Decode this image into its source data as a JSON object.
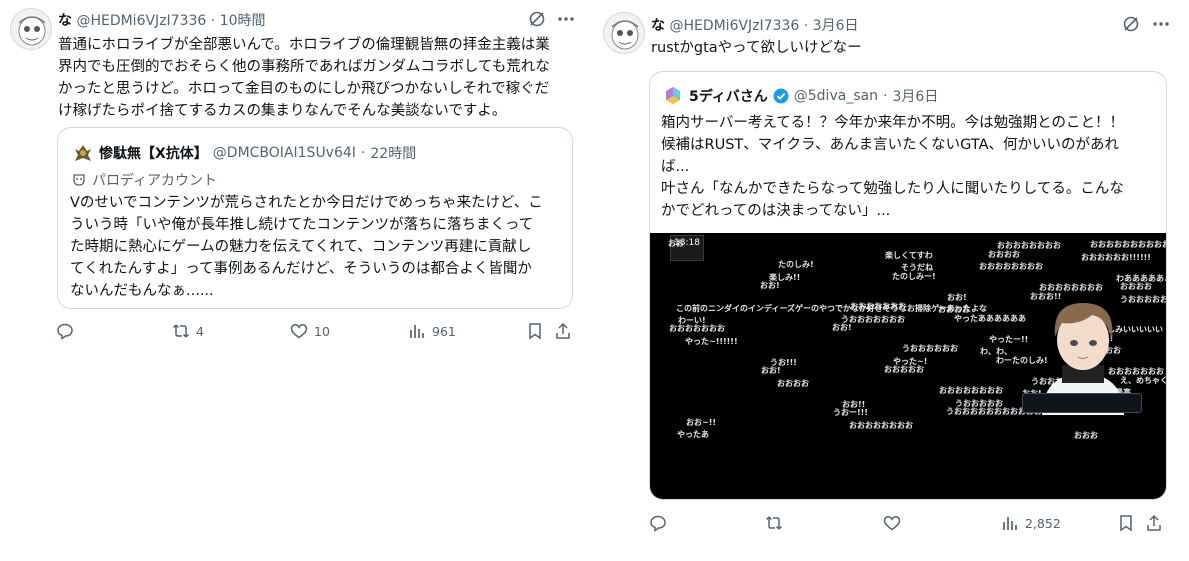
{
  "left_tweet": {
    "display_name": "な",
    "handle": "@HEDMi6VJzI7336",
    "time": "10時間",
    "text_lines": [
      "普通にホロライブが全部悪いんで。ホロライブの倫理観皆無の拝金主義は業",
      "界内でも圧倒的でおそらく他の事務所であればガンダムコラボしても荒れな",
      "かったと思うけど。ホロって金目のものにしか飛びつかないしそれで稼ぐだ",
      "け稼げたらポイ捨てするカスの集まりなんでそんな美談ないですよ。"
    ],
    "quote": {
      "display_name": "惨駄無【X抗体】",
      "handle": "@DMCBOIAI1SUv64I",
      "time": "22時間",
      "parody_label": "パロディアカウント",
      "text_lines": [
        "Vのせいでコンテンツが荒らされたとか今日だけでめっちゃ来たけど、こ",
        "ういう時「いや俺が長年推し続けてたコンテンツが落ちに落ちまくって",
        "た時期に熱心にゲームの魅力を伝えてくれて、コンテンツ再建に貢献し",
        "てくれたんすよ」って事例あるんだけど、そういうのは都合よく皆聞か",
        "ないんだもんなぁ......"
      ]
    },
    "actions": {
      "reply_count": "",
      "retweet_count": "4",
      "like_count": "10",
      "view_count": "961"
    }
  },
  "right_tweet": {
    "display_name": "な",
    "handle": "@HEDMi6VJzI7336",
    "time": "3月6日",
    "text": "rustかgtaやって欲しいけどなー",
    "quote": {
      "display_name": "5ディバさん",
      "handle": "@5diva_san",
      "time": "3月6日",
      "text_lines": [
        "箱内サーバー考えてる！？今年か来年か不明。今は勉強期とのこと！！",
        "候補はRUST、マイクラ、あんま言いたくないGTA、何かいいのがあれ",
        "ば...",
        "叶さん「なんかできたらなって勉強したり人に聞いたりしてる。こんな",
        "かでどれってのは決まってない」..."
      ],
      "video_clock": "18:18",
      "danmaku": [
        "おお",
        "おおおおおお!!!!!!",
        "おおおおおおおお",
        "たのしみー!",
        "おお!",
        "うおおおおおおあっつい",
        "この前のニンダイのインディーズゲーのやつでかなか好きそうなお掃除ゲーあったよな",
        "やったああああああ",
        "おお!",
        "やった~!!!!!!",
        "おおおおおお",
        "わーたのしみ!",
        "おおおおお",
        "おおおお",
        "最高",
        "楽しみです!",
        "うおおおおおおおおおおおおおおお",
        "おおおおおおおお",
        "やったあ",
        "おおおおおおおおおおおお",
        "おおおお",
        "そうだね",
        "楽しみ!!",
        "おおおお",
        "おおお!!",
        "おおおお",
        "うおおおおおおお",
        "おおおおおおお",
        "楽しみ!!",
        "わ、わ、",
        "やった~!",
        "おお!",
        "え、めちゃくちゃ",
        "おお!",
        "うおおおおお",
        "うおー!!!",
        "おお~!!",
        "おおお",
        "おおおおおおおお",
        "楽しくてすわ",
        "たのしみ!",
        "わあああああぁ",
        "おおおおおおおお",
        "おお!",
        "おおおおおおお",
        "わーい!",
        "たのしみいいいいい",
        "やったー!!",
        "うおおおおおお",
        "うお!!!",
        "おおおおおおお",
        "うおおおおお",
        "おおおおおおおお",
        "おお!!"
      ]
    },
    "actions": {
      "reply_count": "",
      "retweet_count": "",
      "like_count": "",
      "view_count": "2,852"
    }
  },
  "colors": {
    "accent": "#1d9bf0",
    "secondary_text": "#536471",
    "border": "#cfd9de"
  },
  "icons": [
    "grok-icon",
    "more-icon",
    "reply-icon",
    "retweet-icon",
    "like-icon",
    "views-icon",
    "bookmark-icon",
    "share-icon",
    "verified-icon",
    "parody-mask-icon"
  ]
}
